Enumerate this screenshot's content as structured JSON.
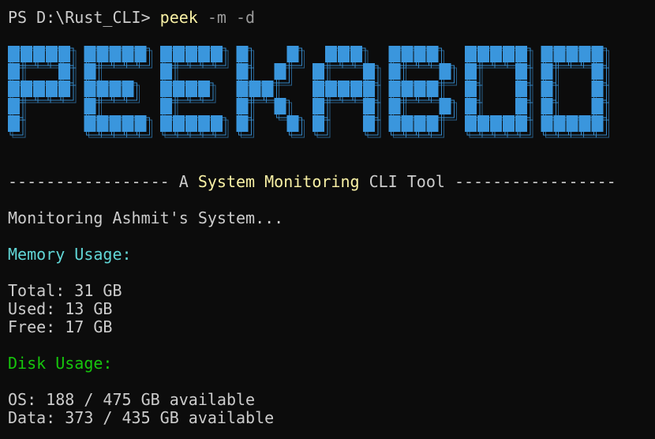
{
  "terminal": {
    "prompt": "PS D:\\Rust_CLI> ",
    "command": "peek",
    "args": " -m -d"
  },
  "banner": {
    "text": "PEEKABOO",
    "face_color": "#3a96dd",
    "outline_color": "#3a96dd"
  },
  "tagline": {
    "dashes_left": "----------------- ",
    "prefix": "A ",
    "highlight": "System Monitoring",
    "suffix": " CLI Tool ",
    "dashes_right": "-----------------"
  },
  "status": "Monitoring Ashmit's System...",
  "memory": {
    "heading": "Memory Usage:",
    "total": "Total: 31 GB",
    "used": "Used: 13 GB",
    "free": "Free: 17 GB"
  },
  "disk": {
    "heading": "Disk Usage:",
    "os": "OS: 188 / 475 GB available",
    "data": "Data: 373 / 435 GB available"
  }
}
